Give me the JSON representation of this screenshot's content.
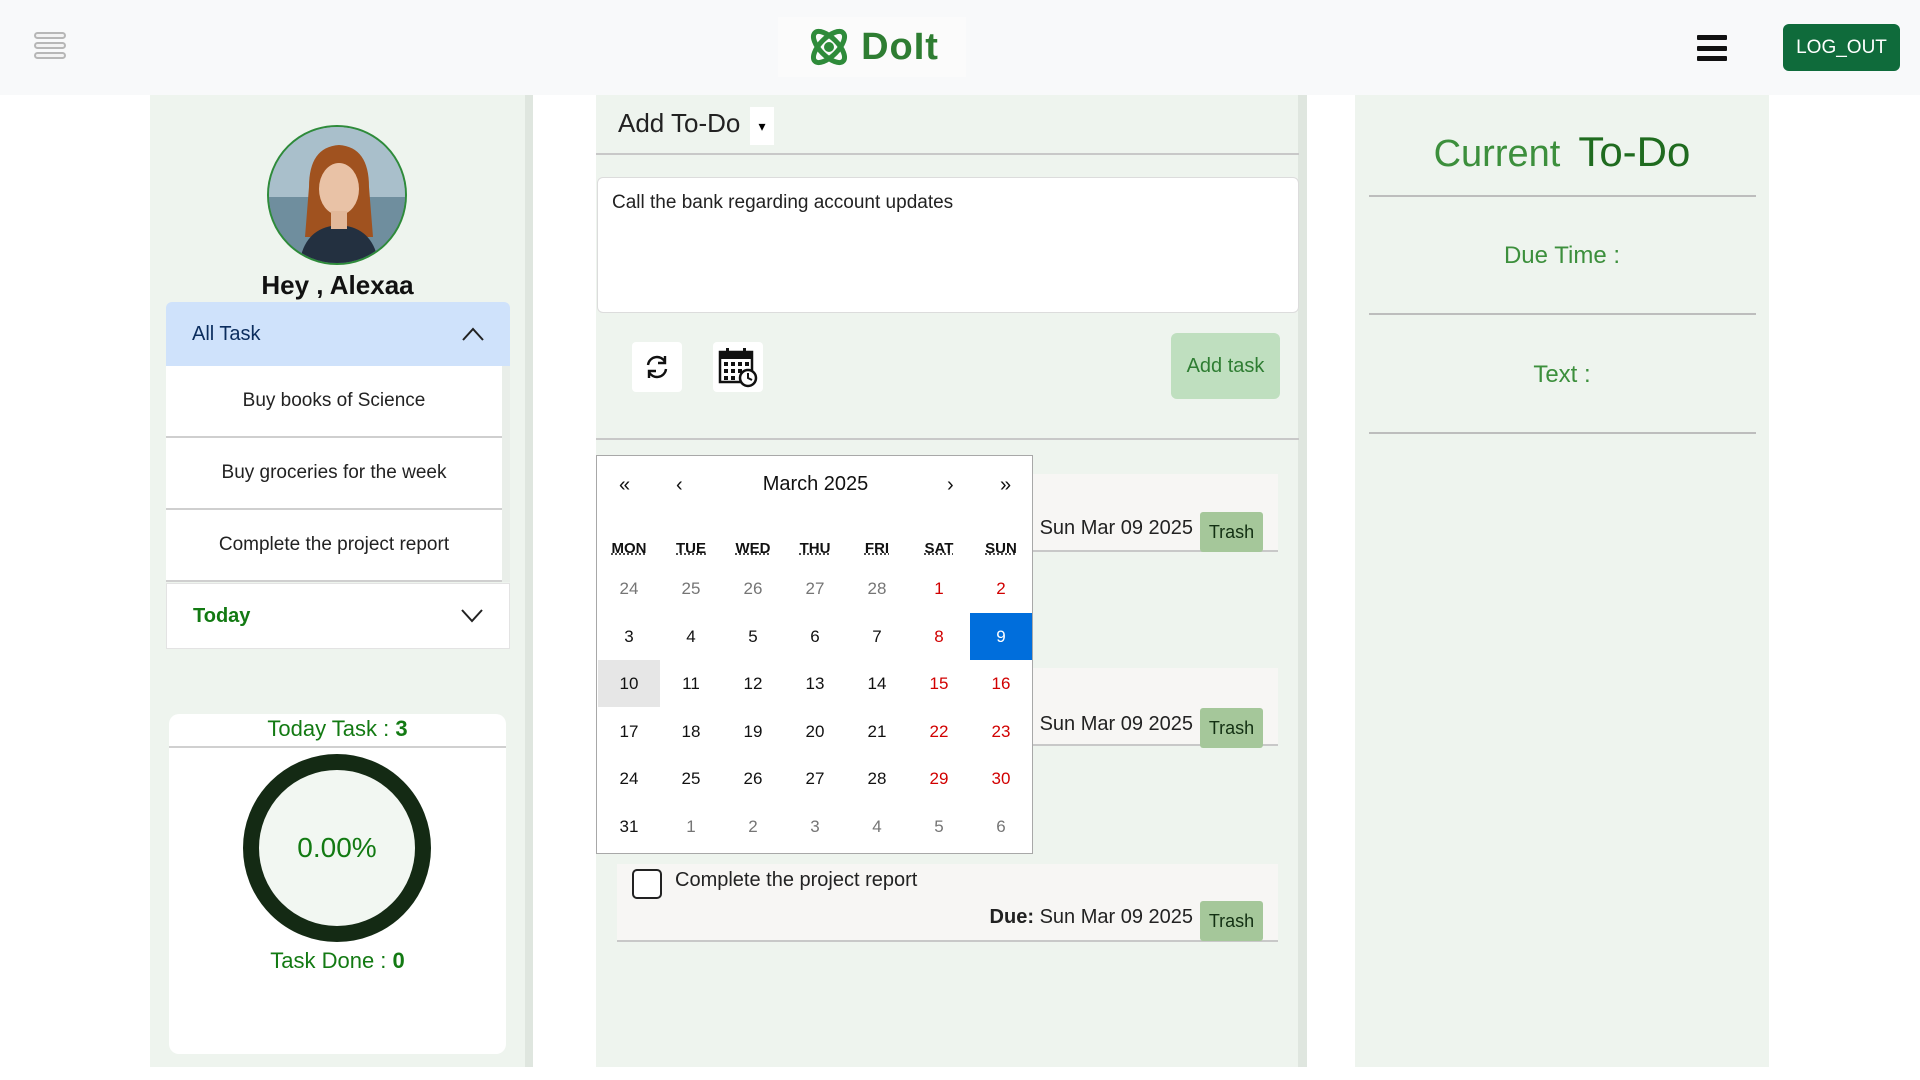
{
  "header": {
    "logo_text": "DoIt",
    "logout_label": "LOG_OUT"
  },
  "sidebar": {
    "greeting": "Hey , Alexaa",
    "all_task_label": "All Task",
    "tasks": [
      "Buy books of Science",
      "Buy groceries for the week",
      "Complete the project report"
    ],
    "today_label": "Today",
    "today_task_label": "Today Task : ",
    "today_task_count": "3",
    "progress_text": "0.00%",
    "progress_fraction": 0,
    "task_done_label": "Task Done : ",
    "task_done_count": "0"
  },
  "composer": {
    "title": "Add To-Do",
    "caret": "▾",
    "text_value": "Call the bank regarding account updates",
    "add_task_label": "Add task"
  },
  "task_list": [
    {
      "title": "",
      "due_label": "",
      "due_date": "Sun Mar 09 2025",
      "trash_label": "Trash"
    },
    {
      "title": "",
      "due_label": "",
      "due_date": "Sun Mar 09 2025",
      "trash_label": "Trash"
    },
    {
      "title": "Complete the project report",
      "due_label": "Due:",
      "due_date": "Sun Mar 09 2025",
      "trash_label": "Trash"
    }
  ],
  "calendar": {
    "prev_year": "«",
    "prev_month": "‹",
    "month_label": "March 2025",
    "next_month": "›",
    "next_year": "»",
    "weekdays": [
      "MON",
      "TUE",
      "WED",
      "THU",
      "FRI",
      "SAT",
      "SUN"
    ],
    "days": [
      [
        "24",
        "25",
        "26",
        "27",
        "28",
        "1",
        "2"
      ],
      [
        "3",
        "4",
        "5",
        "6",
        "7",
        "8",
        "9"
      ],
      [
        "10",
        "11",
        "12",
        "13",
        "14",
        "15",
        "16"
      ],
      [
        "17",
        "18",
        "19",
        "20",
        "21",
        "22",
        "23"
      ],
      [
        "24",
        "25",
        "26",
        "27",
        "28",
        "29",
        "30"
      ],
      [
        "31",
        "1",
        "2",
        "3",
        "4",
        "5",
        "6"
      ]
    ],
    "selected_day": "9",
    "highlighted_day": "10"
  },
  "current": {
    "title_1": "Current",
    "title_2": "To-Do",
    "due_time_label": "Due Time :",
    "text_label": "Text :"
  },
  "colors": {
    "accent_green": "#137a13",
    "logout_bg": "#0f6b3b",
    "selected_day_bg": "#006edc",
    "weekend": "#d10000"
  }
}
